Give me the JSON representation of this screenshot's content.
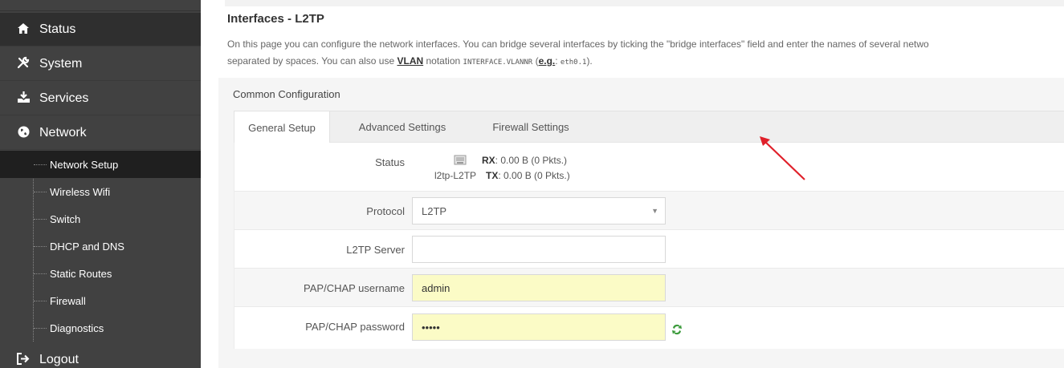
{
  "sidebar": {
    "menu": [
      {
        "label": "Status",
        "icon": "home-icon"
      },
      {
        "label": "System",
        "icon": "tools-icon"
      },
      {
        "label": "Services",
        "icon": "download-icon"
      },
      {
        "label": "Network",
        "icon": "globe-icon"
      },
      {
        "label": "Logout",
        "icon": "logout-icon"
      }
    ],
    "network_items": [
      {
        "label": "Network Setup",
        "active": true
      },
      {
        "label": "Wireless Wifi"
      },
      {
        "label": "Switch"
      },
      {
        "label": "DHCP and DNS"
      },
      {
        "label": "Static Routes"
      },
      {
        "label": "Firewall"
      },
      {
        "label": "Diagnostics"
      }
    ]
  },
  "page": {
    "title": "Interfaces - L2TP",
    "desc_line1": "On this page you can configure the network interfaces. You can bridge several interfaces by ticking the \"bridge interfaces\" field and enter the names of several netwo",
    "desc_line2_a": "separated by spaces. You can also use ",
    "desc_vlan": "VLAN",
    "desc_line2_b": " notation ",
    "desc_code": "INTERFACE.VLANNR",
    "desc_line2_c": " (",
    "desc_eg": "e.g.",
    "desc_line2_d": ": ",
    "desc_example": "eth0.1",
    "desc_line2_e": ")."
  },
  "section": {
    "title": "Common Configuration",
    "tabs": [
      "General Setup",
      "Advanced Settings",
      "Firewall Settings"
    ]
  },
  "form": {
    "status_label": "Status",
    "iface_name": "l2tp-L2TP",
    "rx_key": "RX",
    "rx_value": ": 0.00 B (0 Pkts.)",
    "tx_key": "TX",
    "tx_value": ": 0.00 B (0 Pkts.)",
    "protocol_label": "Protocol",
    "protocol_value": "L2TP",
    "server_label": "L2TP Server",
    "server_value": "",
    "username_label": "PAP/CHAP username",
    "username_value": "admin",
    "password_label": "PAP/CHAP password",
    "password_value": "•••••"
  },
  "colors": {
    "sidebar_bg": "#414141",
    "active_item_bg": "#1f1f1f",
    "autofill_yellow": "#fbfbc6",
    "annotation_arrow": "#e0202a"
  }
}
